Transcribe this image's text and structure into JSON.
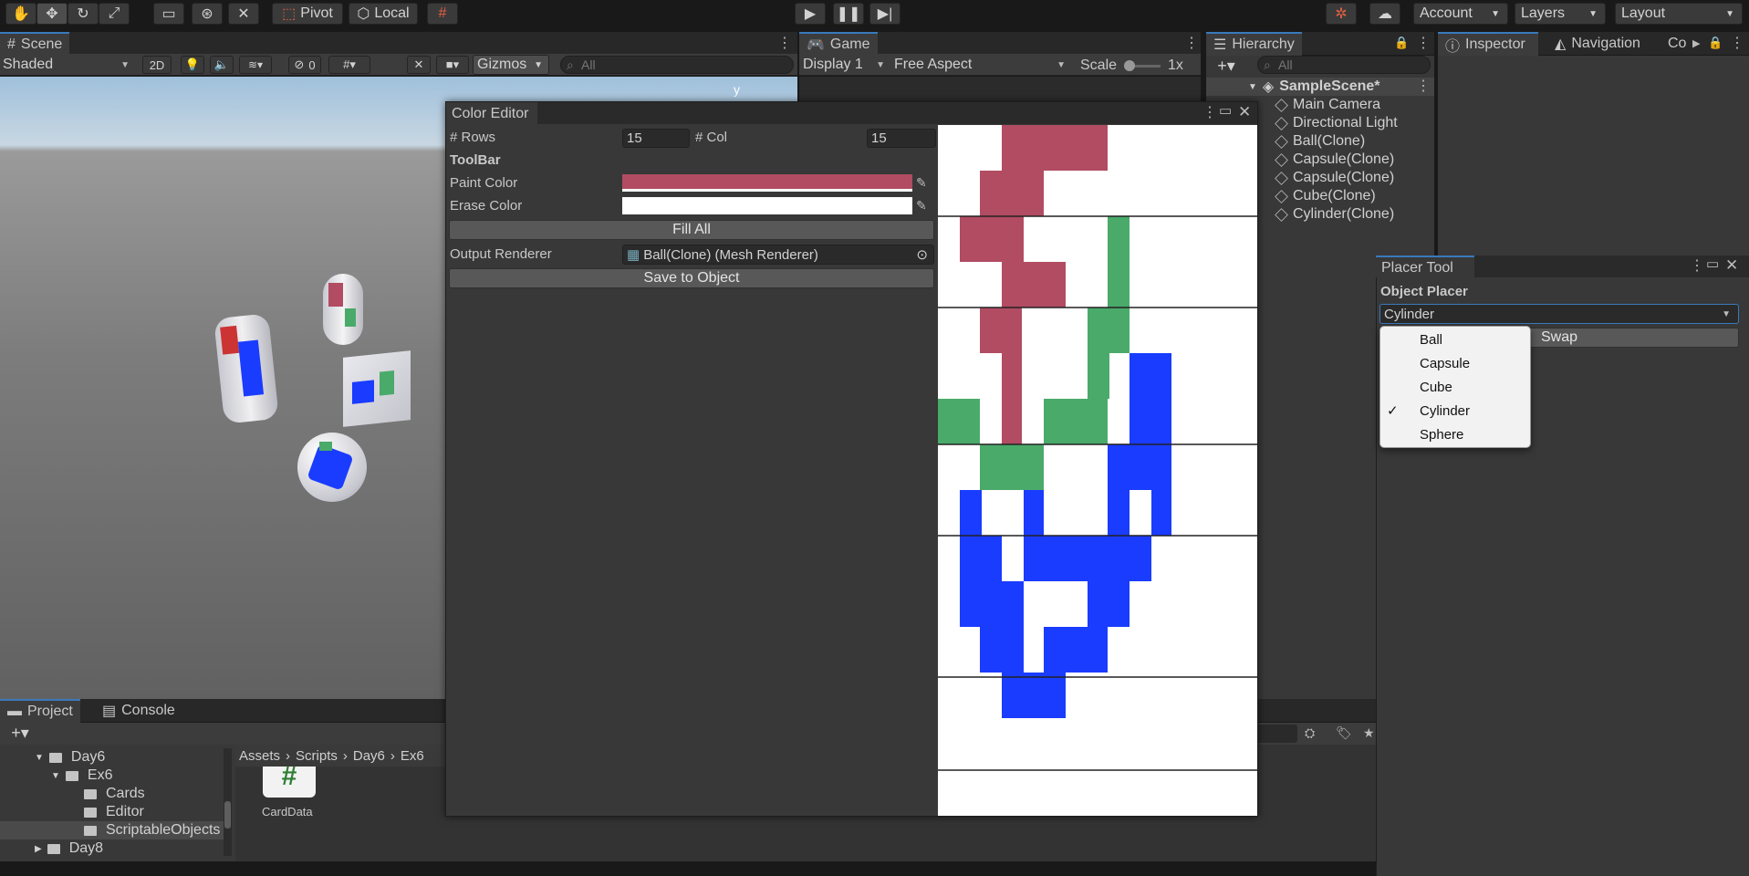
{
  "toolbar": {
    "pivot": "Pivot",
    "local": "Local",
    "account": "Account",
    "layers": "Layers",
    "layout": "Layout"
  },
  "scene": {
    "tab": "Scene",
    "shading": "Shaded",
    "mode2d": "2D",
    "hidden_count": "0",
    "gizmos": "Gizmos",
    "search_placeholder": "All",
    "axis_label": "y"
  },
  "game": {
    "tab": "Game",
    "display": "Display 1",
    "aspect": "Free Aspect",
    "scale_label": "Scale",
    "scale_value": "1x"
  },
  "hierarchy": {
    "tab": "Hierarchy",
    "search_placeholder": "All",
    "scene_name": "SampleScene*",
    "items": [
      "Main Camera",
      "Directional Light",
      "Ball(Clone)",
      "Capsule(Clone)",
      "Capsule(Clone)",
      "Cube(Clone)",
      "Cylinder(Clone)"
    ]
  },
  "inspector": {
    "tab": "Inspector",
    "navigation_tab": "Navigation",
    "third_tab": "Co"
  },
  "color_editor": {
    "title": "Color Editor",
    "rows_label": "# Rows",
    "rows_value": "15",
    "col_label": "# Col",
    "col_value": "15",
    "toolbar_heading": "ToolBar",
    "paint_label": "Paint Color",
    "paint_color": "#b14c62",
    "erase_label": "Erase Color",
    "erase_color": "#ffffff",
    "fill_all": "Fill All",
    "output_label": "Output Renderer",
    "output_value": "Ball(Clone) (Mesh Renderer)",
    "save": "Save to Object"
  },
  "placer_tool": {
    "title": "Placer Tool",
    "heading": "Object Placer",
    "selected": "Cylinder",
    "swap": "Swap",
    "options": [
      "Ball",
      "Capsule",
      "Cube",
      "Cylinder",
      "Sphere"
    ]
  },
  "project": {
    "tab": "Project",
    "console_tab": "Console",
    "tree": [
      "Day6",
      "Ex6",
      "Cards",
      "Editor",
      "ScriptableObjects",
      "Day8"
    ],
    "breadcrumb": [
      "Assets",
      "Scripts",
      "Day6",
      "Ex6"
    ],
    "asset_name": "CardData",
    "asset_glyph": "#"
  },
  "colors": {
    "maroon": "#b14c62",
    "green": "#4aaa6a",
    "blue": "#1a3cff",
    "accent": "#3a79bb"
  }
}
